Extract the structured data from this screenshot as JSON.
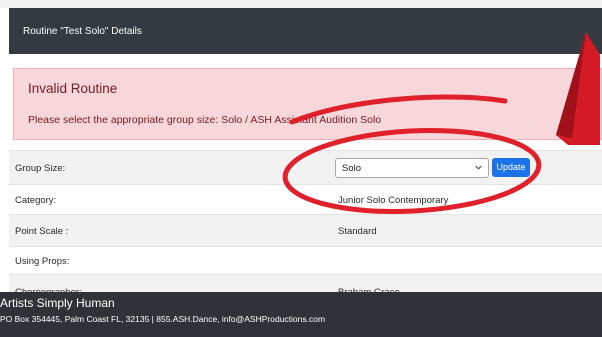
{
  "modal": {
    "title": "Routine \"Test Solo\" Details"
  },
  "alert": {
    "title": "Invalid Routine",
    "message": "Please select the appropriate group size: Solo / ASH Assistant Audition Solo"
  },
  "details": {
    "group_size": {
      "label": "Group Size:",
      "selected": "Solo",
      "button": "Update"
    },
    "category": {
      "label": "Category:",
      "value": "Junior Solo Contemporary"
    },
    "point_scale": {
      "label": "Point Scale :",
      "value": "Standard"
    },
    "using_props": {
      "label": "Using Props:",
      "value": ""
    },
    "choreographer": {
      "label": "Choreographer:",
      "value": "Braham Grace"
    }
  },
  "footer": {
    "title": "Artists Simply Human",
    "address": "PO Box 354445, Palm Coast FL, 32135 | 855.ASH.Dance, info@ASHProductions.com"
  },
  "colors": {
    "header_bg": "#343a40",
    "alert_bg": "#f8d7da",
    "alert_text": "#721c24",
    "button": "#1a73e8",
    "annotation_red": "#e0202a",
    "footer_bg": "#2f3236"
  }
}
